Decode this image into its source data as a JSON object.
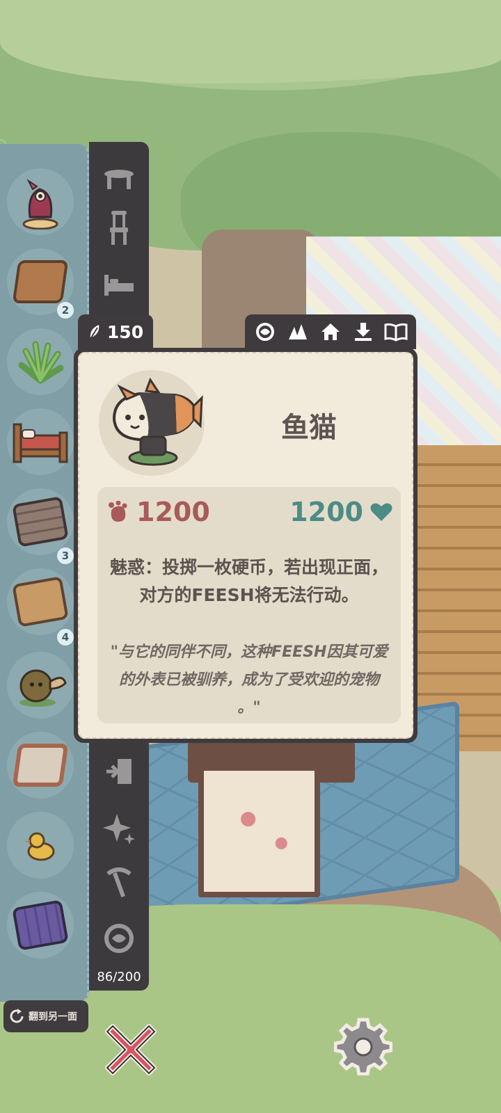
{
  "resources": {
    "currency_icon": "leaf-currency-icon",
    "currency_amount": "150"
  },
  "card": {
    "name": "鱼猫",
    "attack": "1200",
    "health": "1200",
    "ability_text": "魅惑：投掷一枚硬币，若出现正面，对方的FEESH将无法行动。",
    "flavor_text": "\"与它的同伴不同，这种FEESH因其可爱的外表已被驯养，成为了受欢迎的宠物 。\"",
    "tools": [
      "feesh-icon",
      "mountain-icon",
      "house-icon",
      "download-icon",
      "book-icon"
    ]
  },
  "inventory": {
    "items": [
      {
        "name": "dragon-figurine"
      },
      {
        "name": "wooden-crate",
        "count": "2"
      },
      {
        "name": "green-plant"
      },
      {
        "name": "wooden-bed"
      },
      {
        "name": "stone-floor-roll",
        "count": "3"
      },
      {
        "name": "wood-floor-roll",
        "count": "4"
      },
      {
        "name": "turtle-plush"
      },
      {
        "name": "tile-crate"
      },
      {
        "name": "rubber-duck"
      },
      {
        "name": "purple-wall-roll"
      }
    ],
    "counter": "86/200"
  },
  "categories": [
    "table-icon",
    "chair-icon",
    "bed-icon",
    "door-icon",
    "sparkle-icon",
    "pickaxe-icon",
    "feesh-icon"
  ],
  "flip_button": {
    "label": "翻到另一面"
  },
  "colors": {
    "attack": "#a85a5a",
    "health": "#4c8c86",
    "panel_dark": "#3f3a3d",
    "card_bg": "#f2ebdc"
  }
}
